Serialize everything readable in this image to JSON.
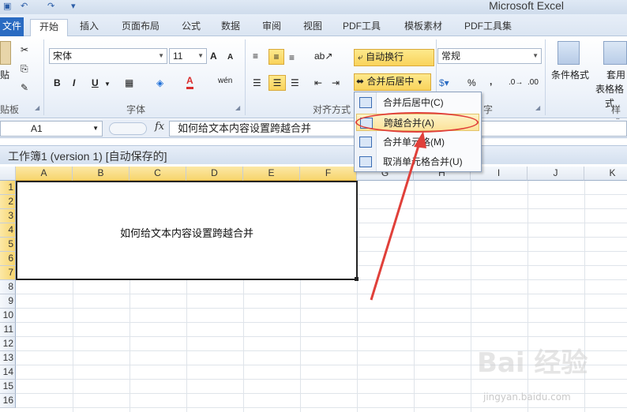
{
  "app": {
    "title": "Microsoft Excel",
    "qa_undo": "↶",
    "qa_redo": "↷",
    "qa_more": "▾"
  },
  "tabs": [
    {
      "label": "文件"
    },
    {
      "label": "开始"
    },
    {
      "label": "插入"
    },
    {
      "label": "页面布局"
    },
    {
      "label": "公式"
    },
    {
      "label": "数据"
    },
    {
      "label": "审阅"
    },
    {
      "label": "视图"
    },
    {
      "label": "PDF工具"
    },
    {
      "label": "模板素材"
    },
    {
      "label": "PDF工具集"
    }
  ],
  "ribbon": {
    "clipboard": {
      "label": "贴板",
      "paste": "贴"
    },
    "font": {
      "label": "字体",
      "name": "宋体",
      "size": "11",
      "grow": "A",
      "shrink": "A",
      "bold": "B",
      "italic": "I",
      "underline": "U",
      "color_glyph": "A",
      "wen": "wén"
    },
    "alignment": {
      "label": "对齐方式",
      "wrap": "自动换行",
      "merge": "合并后居中"
    },
    "number": {
      "label": "字",
      "format": "常规",
      "percent": "%",
      "comma": ","
    },
    "styles": {
      "conditional": "条件格式",
      "table1": "套用",
      "table2": "表格格式",
      "label": "样式"
    }
  },
  "formula_bar": {
    "cell": "A1",
    "fx": "fx",
    "value": "如何给文本内容设置跨越合并"
  },
  "workbook": {
    "title": "工作簿1 (version 1) [自动保存的]"
  },
  "grid": {
    "columns": [
      "A",
      "B",
      "C",
      "D",
      "E",
      "F",
      "G",
      "H",
      "I",
      "J",
      "K"
    ],
    "rows": [
      "1",
      "2",
      "3",
      "4",
      "5",
      "6",
      "7",
      "8",
      "9",
      "10",
      "11",
      "12",
      "13",
      "14",
      "15",
      "16"
    ],
    "merged_text": "如何给文本内容设置跨越合并"
  },
  "merge_menu": {
    "items": [
      {
        "label": "合并后居中(C)"
      },
      {
        "label": "跨越合并(A)"
      },
      {
        "label": "合并单元格(M)"
      },
      {
        "label": "取消单元格合并(U)"
      }
    ]
  },
  "watermark": {
    "text": "Bai 经验",
    "sub": "jingyan.baidu.com"
  },
  "colors": {
    "accent": "#2a6bc2",
    "highlight": "#f9d35b",
    "annotation": "#e0403a"
  }
}
